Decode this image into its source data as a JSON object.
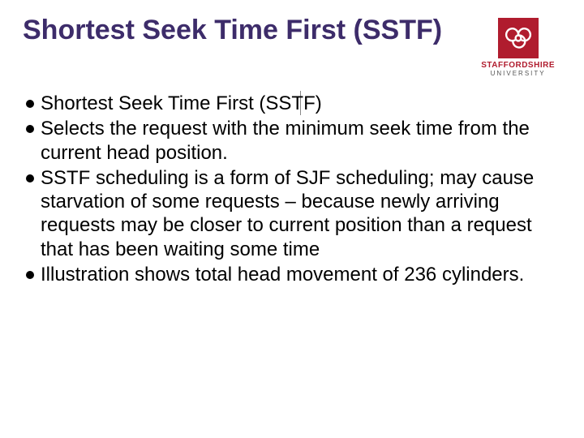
{
  "title": "Shortest Seek Time First (SSTF)",
  "logo": {
    "name": "STAFFORDSHIRE",
    "sub": "UNIVERSITY"
  },
  "bullets": [
    "Shortest Seek Time First (SSTF)",
    "Selects the request with the minimum seek time from the current head position.",
    "SSTF scheduling is a form of SJF scheduling; may cause starvation of some requests – because newly arriving requests may be closer to current position than a request that has been waiting some time",
    "Illustration shows total head movement of 236 cylinders."
  ]
}
